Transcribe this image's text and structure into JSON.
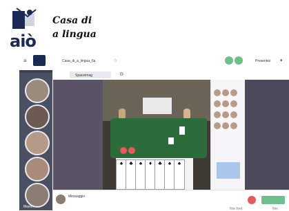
{
  "header": {
    "logo_text": "aiò",
    "title_line1": "Casa di",
    "title_line2": "a lingua"
  },
  "window": {
    "doc_title": "Casa_di_a_lingua_6a",
    "tab_label": "Spaceimag",
    "presenter_label": "Presentez",
    "sidebar_footer": "Mason"
  },
  "colors": {
    "sidebar": "#4a4f61",
    "felt": "#2c6b3a",
    "accent_green": "#6ec18c",
    "accent_red": "#e85a5a"
  },
  "bottom": {
    "chat_label": "Messaggio",
    "left_text": "fine livet",
    "right_text": "fine"
  }
}
